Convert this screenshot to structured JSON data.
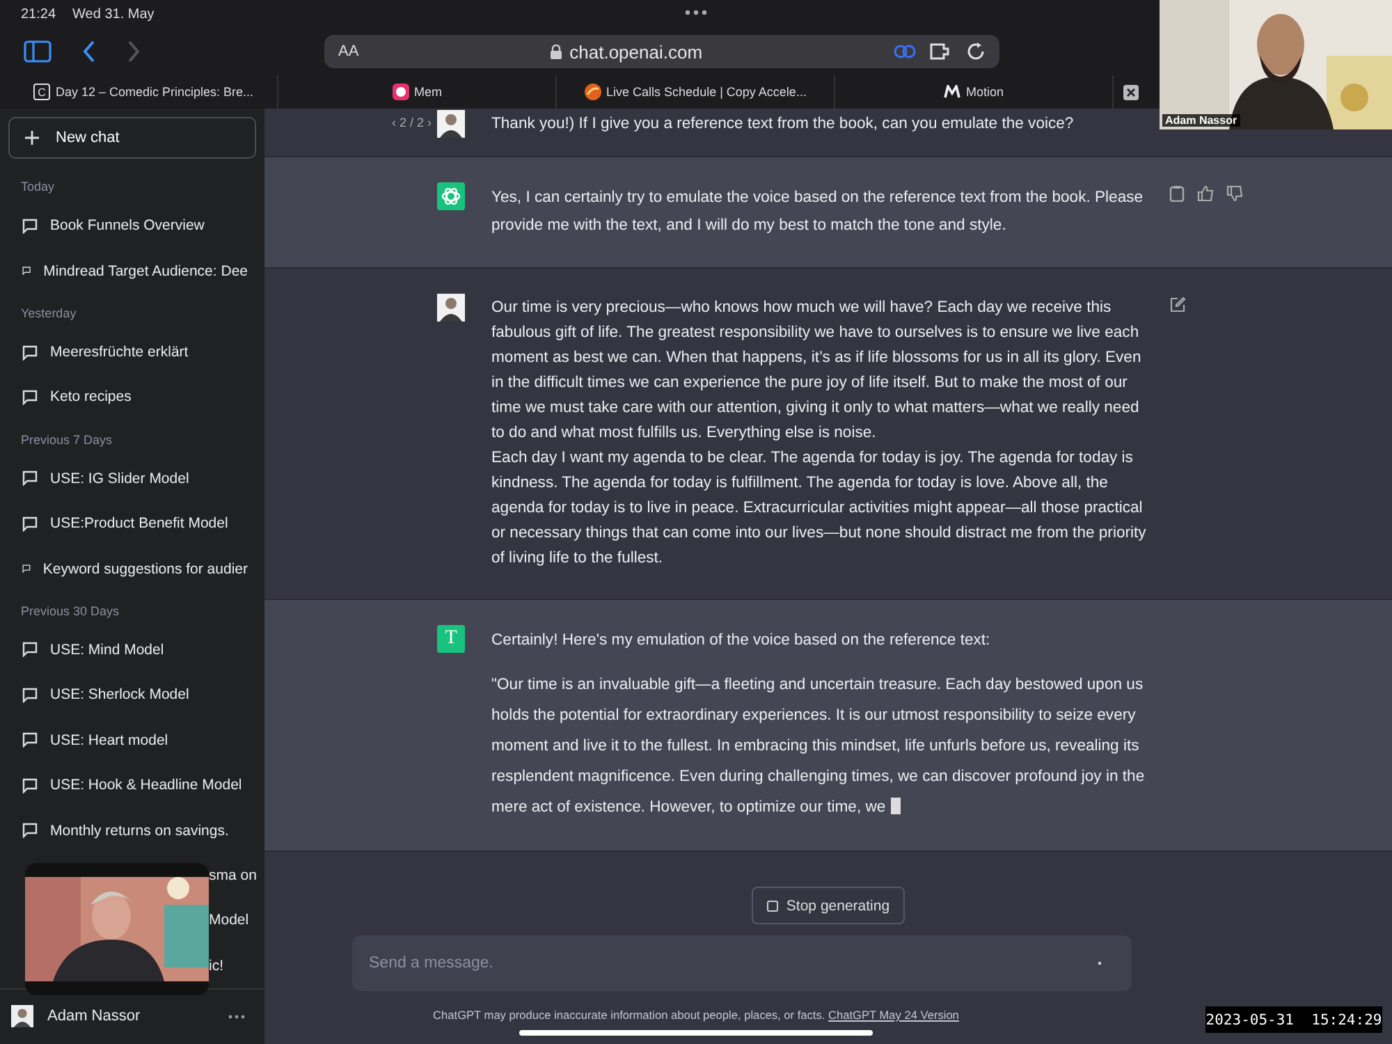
{
  "status_bar": {
    "time": "21:24",
    "date": "Wed 31. May"
  },
  "browser": {
    "text_size": "AA",
    "url": "chat.openai.com",
    "tabs": [
      {
        "label": "Day 12 – Comedic Principles: Bre...",
        "favicon_text": "C"
      },
      {
        "label": "Mem"
      },
      {
        "label": "Live Calls Schedule | Copy Accele..."
      },
      {
        "label": "Motion"
      }
    ]
  },
  "sidebar": {
    "new_chat": "New chat",
    "sections": [
      {
        "heading": "Today",
        "items": [
          {
            "title": "Book Funnels Overview",
            "kind": "chat"
          },
          {
            "title": "Mindread Target Audience: Dee",
            "kind": "chat"
          }
        ]
      },
      {
        "heading": "Yesterday",
        "items": [
          {
            "title": "Meeresfrüchte erklärt",
            "kind": "chat"
          },
          {
            "title": "Keto recipes",
            "kind": "chat"
          }
        ]
      },
      {
        "heading": "Previous 7 Days",
        "items": [
          {
            "title": "USE: IG Slider Model",
            "kind": "chat"
          },
          {
            "title": "USE:Product Benefit Model",
            "kind": "chat"
          },
          {
            "title": "Keyword suggestions for audier",
            "kind": "chat"
          }
        ]
      },
      {
        "heading": "Previous 30 Days",
        "items": [
          {
            "title": "USE: Mind Model",
            "kind": "chat"
          },
          {
            "title": "USE: Sherlock Model",
            "kind": "chat"
          },
          {
            "title": "USE: Heart model",
            "kind": "chat"
          },
          {
            "title": "USE: Hook & Headline Model",
            "kind": "chat"
          },
          {
            "title": "Monthly returns on savings.",
            "kind": "chat"
          },
          {
            "title": "sma on",
            "kind": "partial"
          },
          {
            "title": "Model",
            "kind": "partial"
          },
          {
            "title": "ic!",
            "kind": "partial"
          }
        ]
      }
    ],
    "user": "Adam Nassor"
  },
  "chat": {
    "pager": "‹ 2 / 2 ›",
    "messages": [
      {
        "kind": "user_cut",
        "streaming": false,
        "paragraphs": [
          "Thank you!) If I give you a reference text from the book, can you emulate the voice?"
        ]
      },
      {
        "kind": "assistant_logo",
        "streaming": false,
        "paragraphs": [
          "Yes, I can certainly try to emulate the voice based on the reference text from the book. Please provide me with the text, and I will do my best to match the tone and style."
        ]
      },
      {
        "kind": "user",
        "streaming": false,
        "paragraphs": [
          "Our time is very precious—who knows how much we will have? Each day we receive this fabulous gift of life. The greatest responsibility we have to ourselves is to ensure we live each moment as best we can. When that happens, it’s as if life blossoms for us in all its glory. Even in the difficult times we can experience the pure joy of life itself. But to make the most of our time we must take care with our attention, giving it only to what matters—what we really need to do and what most fulfills us. Everything else is noise.\nEach day I want my agenda to be clear. The agenda for today is joy. The agenda for today is kindness. The agenda for today is fulfillment. The agenda for today is love. Above all, the agenda for today is to live in peace. Extracurricular activities might appear—all those practical or necessary things that can come into our lives—but none should distract me from the priority of living life to the fullest."
        ]
      },
      {
        "kind": "assistant_letter",
        "avatar_text": "T",
        "streaming": true,
        "paragraphs": [
          "Certainly! Here's my emulation of the voice based on the reference text:",
          "\"Our time is an invaluable gift—a fleeting and uncertain treasure. Each day bestowed upon us holds the potential for extraordinary experiences. It is our utmost responsibility to seize every moment and live it to the fullest. In embracing this mindset, life unfurls before us, revealing its resplendent magnificence. Even during challenging times, we can discover profound joy in the mere act of existence. However, to optimize our time, we"
        ]
      }
    ],
    "stop_button": "Stop generating",
    "input": {
      "placeholder": "Send a message."
    },
    "disclaimer": "ChatGPT may produce inaccurate information about people, places, or facts.",
    "version_link": "ChatGPT May 24 Version"
  },
  "overlays": {
    "camera_name": "Adam Nassor",
    "timestamp": "2023-05-31  15:24:29"
  }
}
